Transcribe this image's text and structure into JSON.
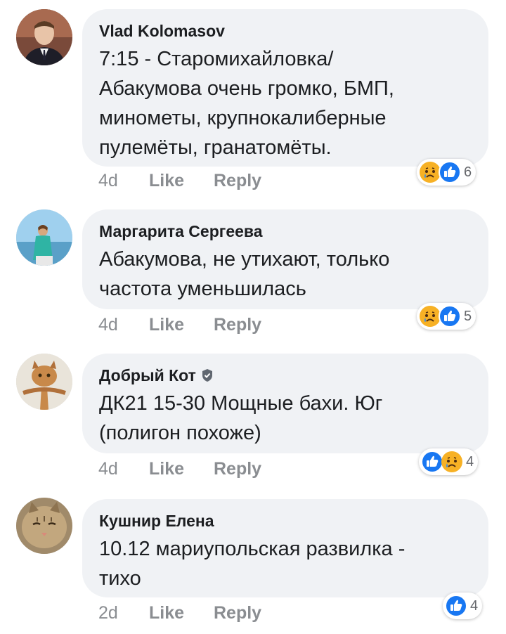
{
  "comments": [
    {
      "author": "Vlad Kolomasov",
      "text": "7:15 - Старомихайловка/\nАбакумова очень громко, БМП,\nминометы, крупнокалиберные\nпулемёты, гранатомёты.",
      "age": "4d",
      "like_label": "Like",
      "reply_label": "Reply",
      "reactions": [
        "sad-icon",
        "like-icon"
      ],
      "reaction_count": "6"
    },
    {
      "author": "Маргарита Сергеева",
      "text": "Абакумова, не утихают, только\nчастота уменьшилась",
      "age": "4d",
      "like_label": "Like",
      "reply_label": "Reply",
      "reactions": [
        "sad-icon",
        "like-icon"
      ],
      "reaction_count": "5"
    },
    {
      "author": "Добрый Кот",
      "verified": true,
      "text": "ДК21 15-30 Мощные бахи. Юг\n(полигон похоже)",
      "age": "4d",
      "like_label": "Like",
      "reply_label": "Reply",
      "reactions": [
        "like-icon",
        "sad-icon"
      ],
      "reaction_count": "4"
    },
    {
      "author": "Кушнир Елена",
      "text": "10.12 мариупольская развилка -\nтихо",
      "age": "2d",
      "like_label": "Like",
      "reply_label": "Reply",
      "reactions": [
        "like-icon"
      ],
      "reaction_count": "4"
    }
  ],
  "colors": {
    "bubble": "#f0f2f5",
    "like_blue": "#1877f2",
    "sad_yellow": "#f7b125",
    "meta_gray": "#8a8d91"
  }
}
